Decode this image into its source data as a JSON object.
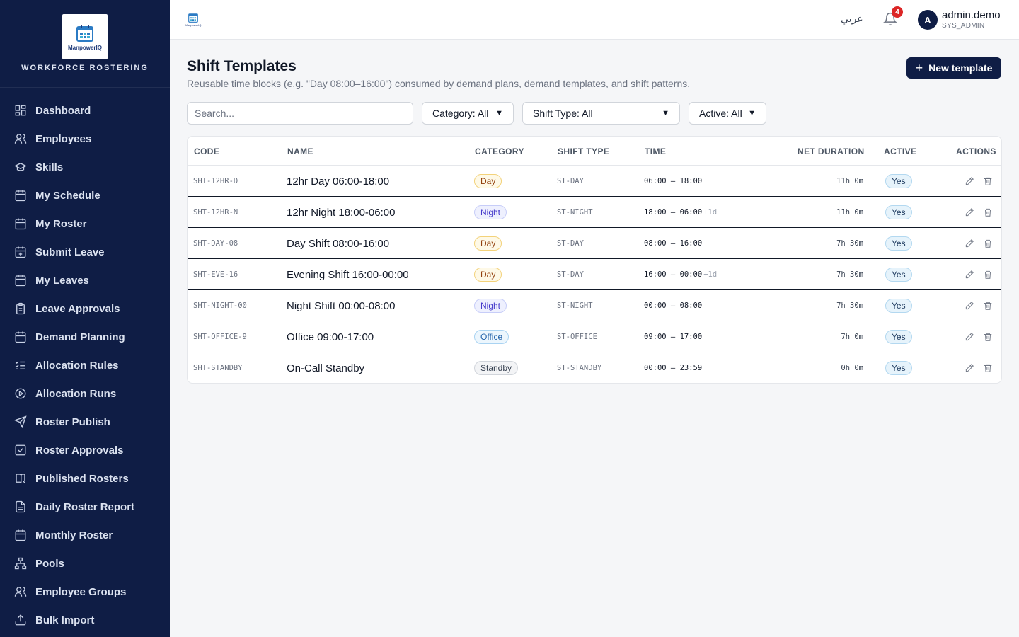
{
  "brand": {
    "logo_text": "ManpowerIQ",
    "title": "WORKFORCE ROSTERING"
  },
  "sidebar": {
    "items": [
      {
        "label": "Dashboard",
        "icon": "dashboard-icon"
      },
      {
        "label": "Employees",
        "icon": "users-icon"
      },
      {
        "label": "Skills",
        "icon": "graduation-cap-icon"
      },
      {
        "label": "My Schedule",
        "icon": "calendar-icon"
      },
      {
        "label": "My Roster",
        "icon": "calendar-icon"
      },
      {
        "label": "Submit Leave",
        "icon": "calendar-plus-icon"
      },
      {
        "label": "My Leaves",
        "icon": "calendar-icon"
      },
      {
        "label": "Leave Approvals",
        "icon": "clipboard-icon"
      },
      {
        "label": "Demand Planning",
        "icon": "calendar-icon"
      },
      {
        "label": "Allocation Rules",
        "icon": "list-check-icon"
      },
      {
        "label": "Allocation Runs",
        "icon": "play-circle-icon"
      },
      {
        "label": "Roster Publish",
        "icon": "send-icon"
      },
      {
        "label": "Roster Approvals",
        "icon": "check-square-icon"
      },
      {
        "label": "Published Rosters",
        "icon": "book-icon"
      },
      {
        "label": "Daily Roster Report",
        "icon": "file-text-icon"
      },
      {
        "label": "Monthly Roster",
        "icon": "calendar-icon"
      },
      {
        "label": "Pools",
        "icon": "hierarchy-icon"
      },
      {
        "label": "Employee Groups",
        "icon": "users-icon"
      },
      {
        "label": "Bulk Import",
        "icon": "upload-icon"
      }
    ]
  },
  "topbar": {
    "logo_text": "ManpowerIQ",
    "language": "عربي",
    "notification_count": "4",
    "user": {
      "initial": "A",
      "name": "admin.demo",
      "role": "SYS_ADMIN"
    }
  },
  "page": {
    "title": "Shift Templates",
    "subtitle": "Reusable time blocks (e.g. \"Day 08:00–16:00\") consumed by demand plans, demand templates, and shift patterns.",
    "new_button": "New template"
  },
  "filters": {
    "search_placeholder": "Search...",
    "category": "Category: All",
    "shift_type": "Shift Type: All",
    "active": "Active: All"
  },
  "table": {
    "columns": [
      "CODE",
      "NAME",
      "CATEGORY",
      "SHIFT TYPE",
      "TIME",
      "NET DURATION",
      "ACTIVE",
      "ACTIONS"
    ],
    "rows": [
      {
        "code": "SHT-12HR-D",
        "name": "12hr Day 06:00-18:00",
        "category": "Day",
        "shift_type": "ST-DAY",
        "time": "06:00 – 18:00",
        "next_day": "",
        "duration": "11h 0m",
        "active": "Yes"
      },
      {
        "code": "SHT-12HR-N",
        "name": "12hr Night 18:00-06:00",
        "category": "Night",
        "shift_type": "ST-NIGHT",
        "time": "18:00 – 06:00",
        "next_day": "+1d",
        "duration": "11h 0m",
        "active": "Yes"
      },
      {
        "code": "SHT-DAY-08",
        "name": "Day Shift 08:00-16:00",
        "category": "Day",
        "shift_type": "ST-DAY",
        "time": "08:00 – 16:00",
        "next_day": "",
        "duration": "7h 30m",
        "active": "Yes"
      },
      {
        "code": "SHT-EVE-16",
        "name": "Evening Shift 16:00-00:00",
        "category": "Day",
        "shift_type": "ST-DAY",
        "time": "16:00 – 00:00",
        "next_day": "+1d",
        "duration": "7h 30m",
        "active": "Yes"
      },
      {
        "code": "SHT-NIGHT-00",
        "name": "Night Shift 00:00-08:00",
        "category": "Night",
        "shift_type": "ST-NIGHT",
        "time": "00:00 – 08:00",
        "next_day": "",
        "duration": "7h 30m",
        "active": "Yes"
      },
      {
        "code": "SHT-OFFICE-9",
        "name": "Office 09:00-17:00",
        "category": "Office",
        "shift_type": "ST-OFFICE",
        "time": "09:00 – 17:00",
        "next_day": "",
        "duration": "7h 0m",
        "active": "Yes"
      },
      {
        "code": "SHT-STANDBY",
        "name": "On-Call Standby",
        "category": "Standby",
        "shift_type": "ST-STANDBY",
        "time": "00:00 – 23:59",
        "next_day": "",
        "duration": "0h 0m",
        "active": "Yes"
      }
    ]
  },
  "colors": {
    "sidebar_bg": "#0f1d45",
    "primary": "#0f1d45",
    "badge": "#dc2626"
  }
}
